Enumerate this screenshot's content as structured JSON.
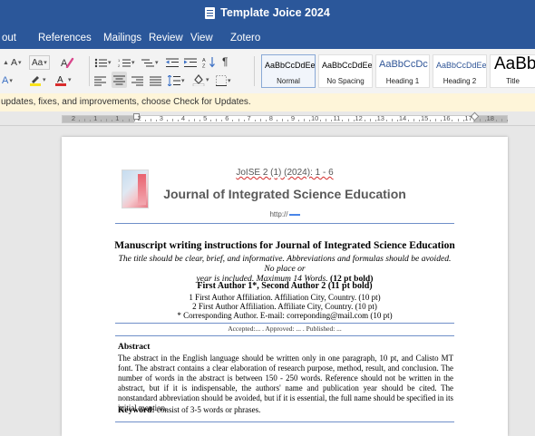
{
  "window": {
    "title": "Template Joice 2024"
  },
  "menu": {
    "tabs": [
      "out",
      "References",
      "Mailings",
      "Review",
      "View",
      "Zotero"
    ]
  },
  "ribbon": {
    "styles": [
      {
        "preview": "AaBbCcDdEe",
        "label": "Normal",
        "selected": true
      },
      {
        "preview": "AaBbCcDdEe",
        "label": "No Spacing"
      },
      {
        "preview": "AaBbCcDc",
        "label": "Heading 1"
      },
      {
        "preview": "AaBbCcDdEe",
        "label": "Heading 2"
      },
      {
        "preview": "AaBb(",
        "label": "Title"
      }
    ]
  },
  "notice": {
    "text": "updates, fixes, and improvements, choose Check for Updates."
  },
  "ruler": {
    "labels": [
      "2",
      "1",
      "1",
      "2",
      "3",
      "4",
      "5",
      "6",
      "7",
      "8",
      "9",
      "10",
      "11",
      "12",
      "13",
      "14",
      "15",
      "16",
      "17",
      "18"
    ]
  },
  "document": {
    "journal_id": "JoISE 2 (1) (2024): 1 - 6",
    "journal_title": "Journal of Integrated Science Education",
    "url": "http://",
    "title": "Manuscript writing instructions for Journal of Integrated Science Education",
    "subtitle_line1": "The title should be clear, brief, and informative. Abbreviations and formulas should be avoided. No place or",
    "subtitle_line2_italic": "year is included. Maximum 14 Words.",
    "subtitle_line2_bold": "(12 pt bold)",
    "authors": "First Author 1*, Second Author 2 (11 pt bold)",
    "affiliation1": "1 First Author Affiliation. Affiliation City, Country. (10 pt)",
    "affiliation2": "2 First Author Affiliation. Affiliate City, Country. (10 pt)",
    "corresponding": "* Corresponding Author. E-mail: correponding@mail.com (10 pt)",
    "dates": "Accepted:... . Approved: ... . Published: ...",
    "abstract_heading": "Abstract",
    "abstract_body": "The abstract in the English language should be written only in one paragraph, 10 pt, and Calisto MT font. The abstract contains a clear elaboration of research purpose, method, result, and conclusion. The number of words in the abstract is between 150 - 250 words. Reference should not be written in the abstract, but if it is indispensable, the authors' name and publication year should be cited. The nonstandard abbreviation should be avoided, but if it is essential, the full name should be specified in its initial mention.",
    "keyword_label": "Keyword:",
    "keyword_text": " consist of 3-5 words or phrases."
  }
}
